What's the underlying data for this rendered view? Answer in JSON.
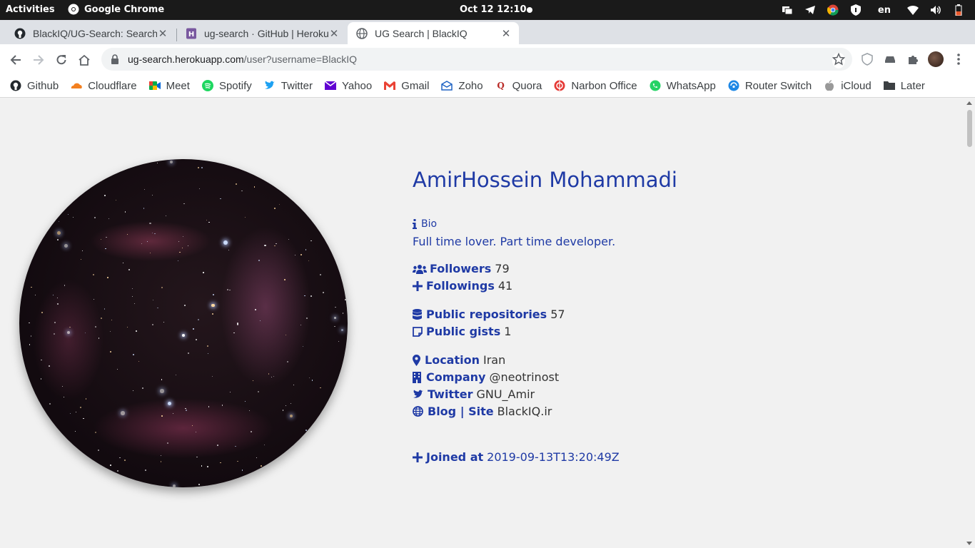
{
  "system_bar": {
    "activities": "Activities",
    "app_name": "Google Chrome",
    "clock": "Oct 12  12:10",
    "language": "en"
  },
  "tabs": [
    {
      "title": "BlackIQ/UG-Search: Search",
      "icon": "github-icon"
    },
    {
      "title": "ug-search · GitHub | Heroku",
      "icon": "heroku-icon"
    },
    {
      "title": "UG Search | BlackIQ",
      "icon": "globe-icon",
      "active": true
    }
  ],
  "address_bar": {
    "host": "ug-search.herokuapp.com",
    "path": "/user?username=BlackIQ"
  },
  "bookmarks": [
    {
      "label": "Github",
      "icon": "github-icon"
    },
    {
      "label": "Cloudflare",
      "icon": "cloudflare-icon"
    },
    {
      "label": "Meet",
      "icon": "meet-icon"
    },
    {
      "label": "Spotify",
      "icon": "spotify-icon"
    },
    {
      "label": "Twitter",
      "icon": "twitter-icon"
    },
    {
      "label": "Yahoo",
      "icon": "yahoo-icon"
    },
    {
      "label": "Gmail",
      "icon": "gmail-icon"
    },
    {
      "label": "Zoho",
      "icon": "zoho-icon"
    },
    {
      "label": "Quora",
      "icon": "quora-icon"
    },
    {
      "label": "Narbon Office",
      "icon": "narbon-icon"
    },
    {
      "label": "WhatsApp",
      "icon": "whatsapp-icon"
    },
    {
      "label": "Router Switch",
      "icon": "router-icon"
    },
    {
      "label": "iCloud",
      "icon": "apple-icon"
    },
    {
      "label": "Later",
      "icon": "folder-icon"
    }
  ],
  "profile": {
    "name": "AmirHossein Mohammadi",
    "bio_label": "Bio",
    "bio": "Full time lover. Part time developer.",
    "followers_label": "Followers",
    "followers": "79",
    "followings_label": "Followings",
    "followings": "41",
    "repos_label": "Public repositories",
    "repos": "57",
    "gists_label": "Public gists",
    "gists": "1",
    "location_label": "Location",
    "location": "Iran",
    "company_label": "Company",
    "company": "@neotrinost",
    "twitter_label": "Twitter",
    "twitter": "GNU_Amir",
    "blog_label": "Blog | Site",
    "blog": "BlackIQ.ir",
    "joined_label": "Joined at",
    "joined": "2019-09-13T13:20:49Z"
  },
  "colors": {
    "accent": "#1f3aa5",
    "page_bg": "#f1f1f1"
  }
}
